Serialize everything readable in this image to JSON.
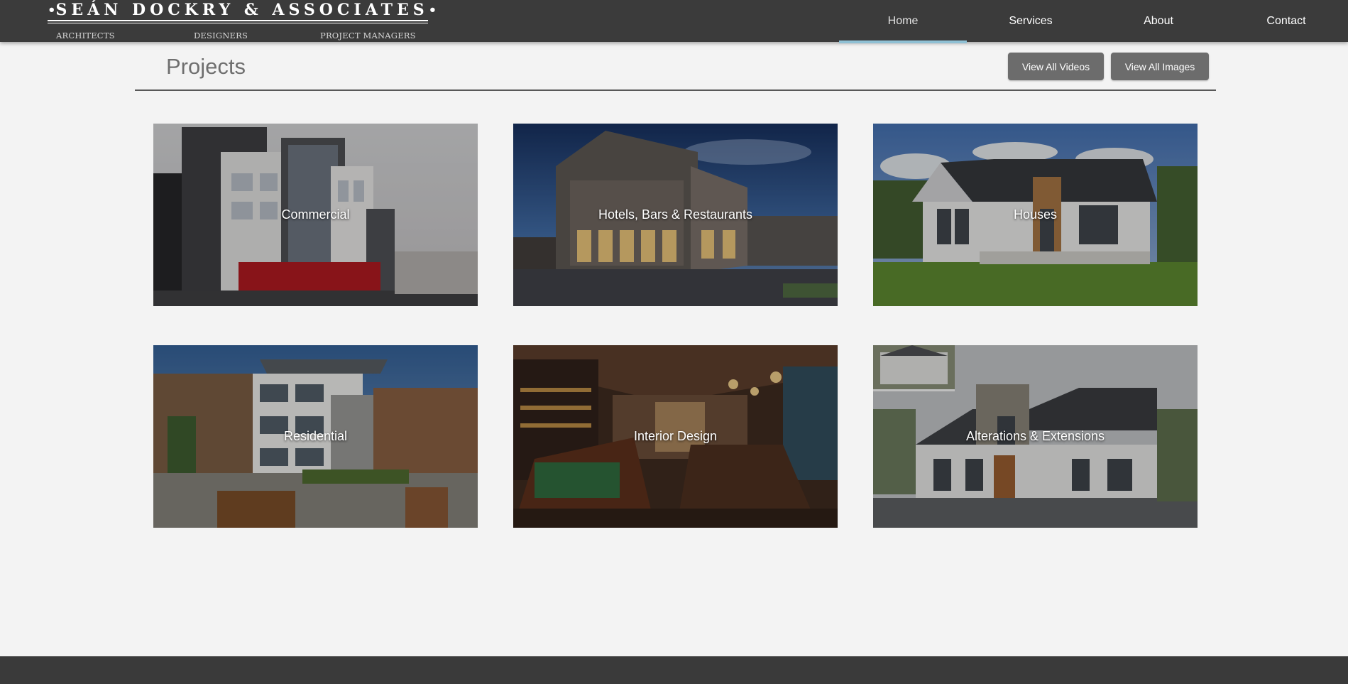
{
  "brand": {
    "name": "SEÁN DOCKRY & ASSOCIATES",
    "dot": "•",
    "roles": [
      "ARCHITECTS",
      "DESIGNERS",
      "PROJECT MANAGERS"
    ]
  },
  "nav": {
    "items": [
      "Home",
      "Services",
      "About",
      "Contact"
    ],
    "active": "Home"
  },
  "page": {
    "title": "Projects",
    "buttons": {
      "videos": "View All Videos",
      "images": "View All Images"
    }
  },
  "projects": [
    {
      "label": "Commercial"
    },
    {
      "label": "Hotels, Bars & Restaurants"
    },
    {
      "label": "Houses"
    },
    {
      "label": "Residential"
    },
    {
      "label": "Interior Design"
    },
    {
      "label": "Alterations & Extensions"
    }
  ],
  "colors": {
    "header_bg": "#3b3b3b",
    "active_underline": "#8fc0d4",
    "page_bg": "#f3f3f3",
    "button_bg": "#6c6c6c",
    "footer_bg": "#3a3a3a"
  }
}
